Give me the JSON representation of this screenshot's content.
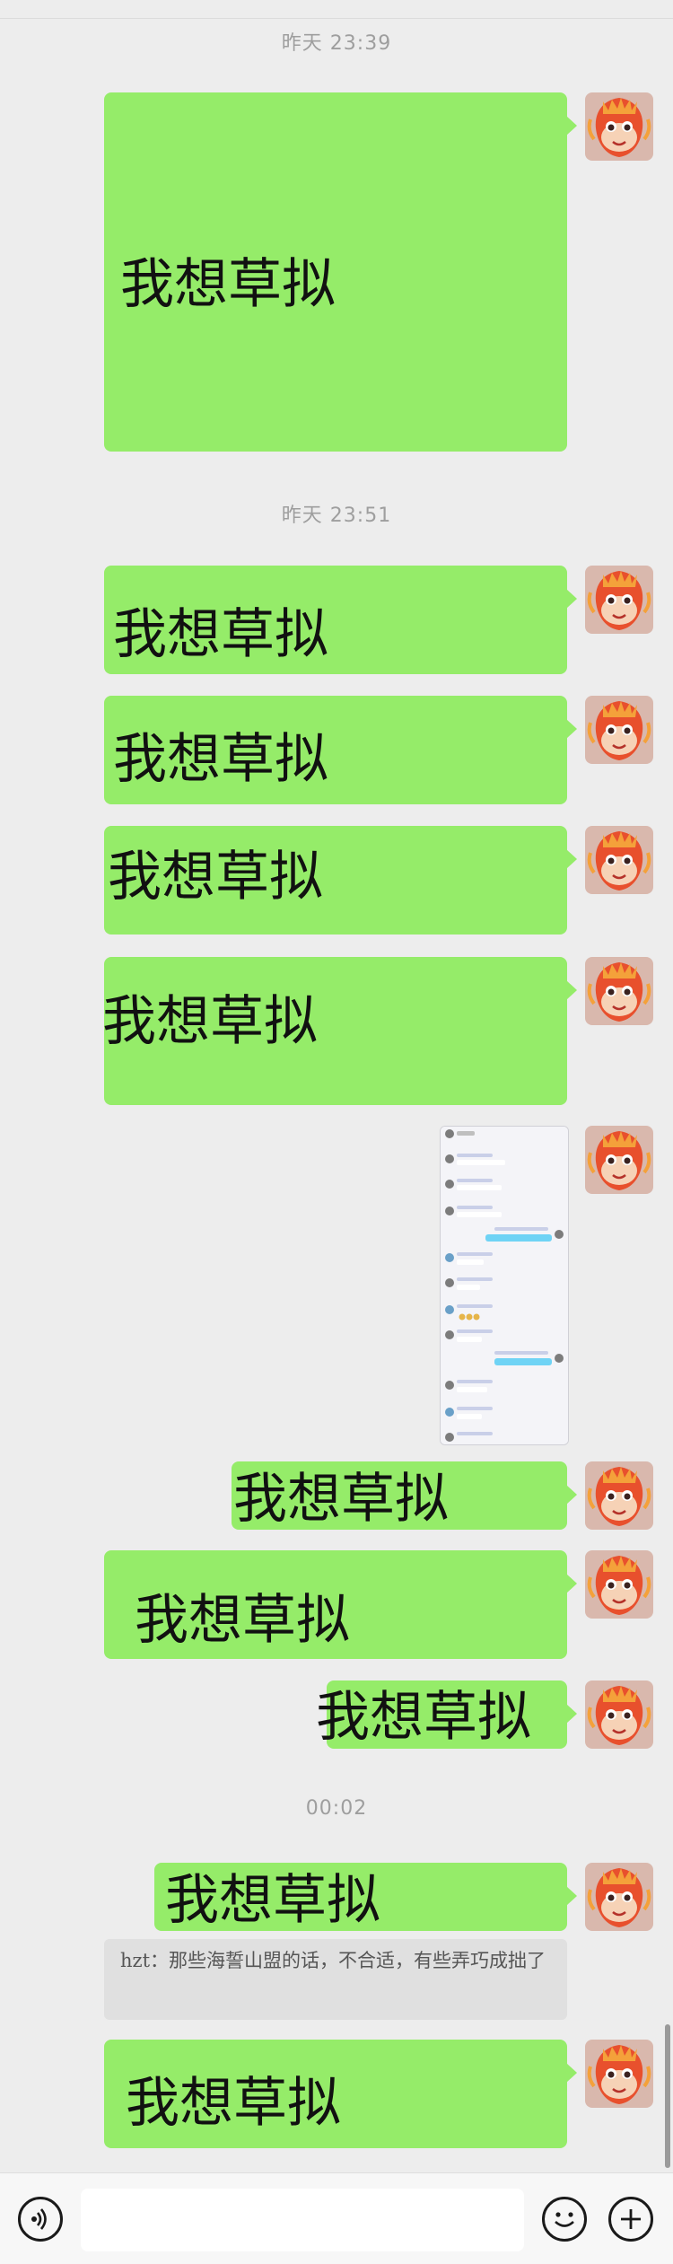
{
  "timestamps": {
    "t1": "昨天 23:39",
    "t2": "昨天 23:51",
    "t3": "00:02"
  },
  "messages": {
    "m1": "我想草拟",
    "m2": "我想草拟",
    "m3": "我想草拟",
    "m4": "我想草拟",
    "m5": "我想草拟",
    "m6": "我想草拟",
    "m7": "我想草拟",
    "m8": "我想草拟",
    "m9": "我想草拟",
    "m10": "我想草拟"
  },
  "quote": {
    "text": "hzt：那些海誓山盟的话，不合适，有些弄巧成拙了"
  },
  "icons": {
    "voice": "voice-icon",
    "emoji": "emoji-icon",
    "more": "plus-icon",
    "avatar": "dragon-avatar"
  },
  "colors": {
    "background": "#ededed",
    "bubble": "#95ec69",
    "timestamp": "#9e9e9e"
  }
}
